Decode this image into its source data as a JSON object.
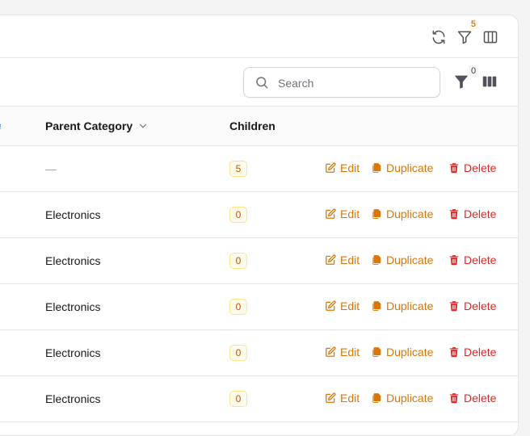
{
  "header": {
    "filter_badge": "5",
    "icons": [
      "refresh-icon",
      "filter-icon",
      "columns-icon"
    ]
  },
  "toolbar": {
    "search_placeholder": "Search",
    "search_value": "",
    "filter_badge": "0"
  },
  "table": {
    "columns": [
      {
        "label": "Parent Category",
        "sortable": true
      },
      {
        "label": "Children",
        "sortable": false
      }
    ],
    "rows": [
      {
        "parent": "—",
        "children": "5"
      },
      {
        "parent": "Electronics",
        "children": "0"
      },
      {
        "parent": "Electronics",
        "children": "0"
      },
      {
        "parent": "Electronics",
        "children": "0"
      },
      {
        "parent": "Electronics",
        "children": "0"
      },
      {
        "parent": "Electronics",
        "children": "0"
      }
    ],
    "actions": {
      "edit": "Edit",
      "duplicate": "Duplicate",
      "delete": "Delete"
    }
  },
  "colors": {
    "accent": "#d97706",
    "danger": "#dc2626",
    "badge_text": "#b45309",
    "badge_bg": "#fffbeb"
  }
}
